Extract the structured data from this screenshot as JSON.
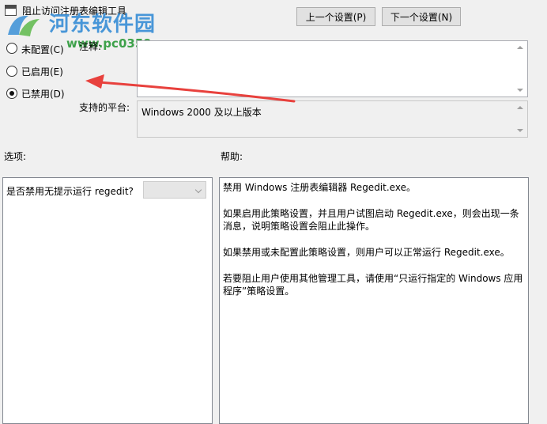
{
  "window": {
    "title": "阻止访问注册表编辑工具"
  },
  "watermark": {
    "brand": "河东软件园",
    "url": "www.pc0359.cn"
  },
  "nav": {
    "prev_label": "上一个设置(P)",
    "next_label": "下一个设置(N)"
  },
  "state": {
    "options": [
      {
        "label": "未配置(C)",
        "checked": false
      },
      {
        "label": "已启用(E)",
        "checked": false
      },
      {
        "label": "已禁用(D)",
        "checked": true
      }
    ]
  },
  "comment": {
    "label": "注释:",
    "value": ""
  },
  "platform": {
    "label": "支持的平台:",
    "value": "Windows 2000 及以上版本"
  },
  "options_section": {
    "label": "选项:",
    "item_label": "是否禁用无提示运行 regedit?",
    "combo_value": ""
  },
  "help_section": {
    "label": "帮助:",
    "paragraphs": [
      "禁用 Windows 注册表编辑器 Regedit.exe。",
      "如果启用此策略设置，并且用户试图启动 Regedit.exe，则会出现一条消息，说明策略设置会阻止此操作。",
      "如果禁用或未配置此策略设置，则用户可以正常运行 Regedit.exe。",
      "若要阻止用户使用其他管理工具，请使用“只运行指定的 Windows 应用程序”策略设置。"
    ]
  },
  "colors": {
    "annotation_arrow": "#e8413d",
    "watermark_blue": "#3a8fd6",
    "watermark_green": "#2e9b3c"
  }
}
